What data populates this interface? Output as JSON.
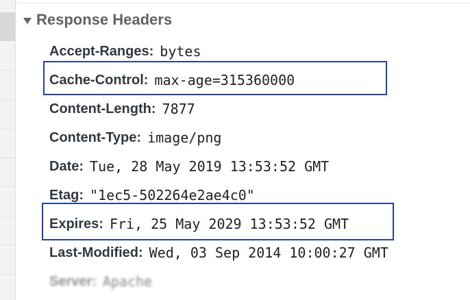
{
  "section": {
    "title": "Response Headers"
  },
  "headers": [
    {
      "name": "Accept-Ranges",
      "value": "bytes"
    },
    {
      "name": "Cache-Control",
      "value": "max-age=315360000"
    },
    {
      "name": "Content-Length",
      "value": "7877"
    },
    {
      "name": "Content-Type",
      "value": "image/png"
    },
    {
      "name": "Date",
      "value": "Tue, 28 May 2019 13:53:52 GMT"
    },
    {
      "name": "Etag",
      "value": "\"1ec5-502264e2ae4c0\""
    },
    {
      "name": "Expires",
      "value": "Fri, 25 May 2029 13:53:52 GMT"
    },
    {
      "name": "Last-Modified",
      "value": "Wed, 03 Sep 2014 10:00:27 GMT"
    },
    {
      "name": "Server",
      "value": "Apache"
    }
  ],
  "colors": {
    "highlight_border": "#1f3fc4",
    "header_name": "#303942",
    "section_title": "#5f6368"
  },
  "icons": {
    "disclosure": "triangle-down-icon"
  }
}
